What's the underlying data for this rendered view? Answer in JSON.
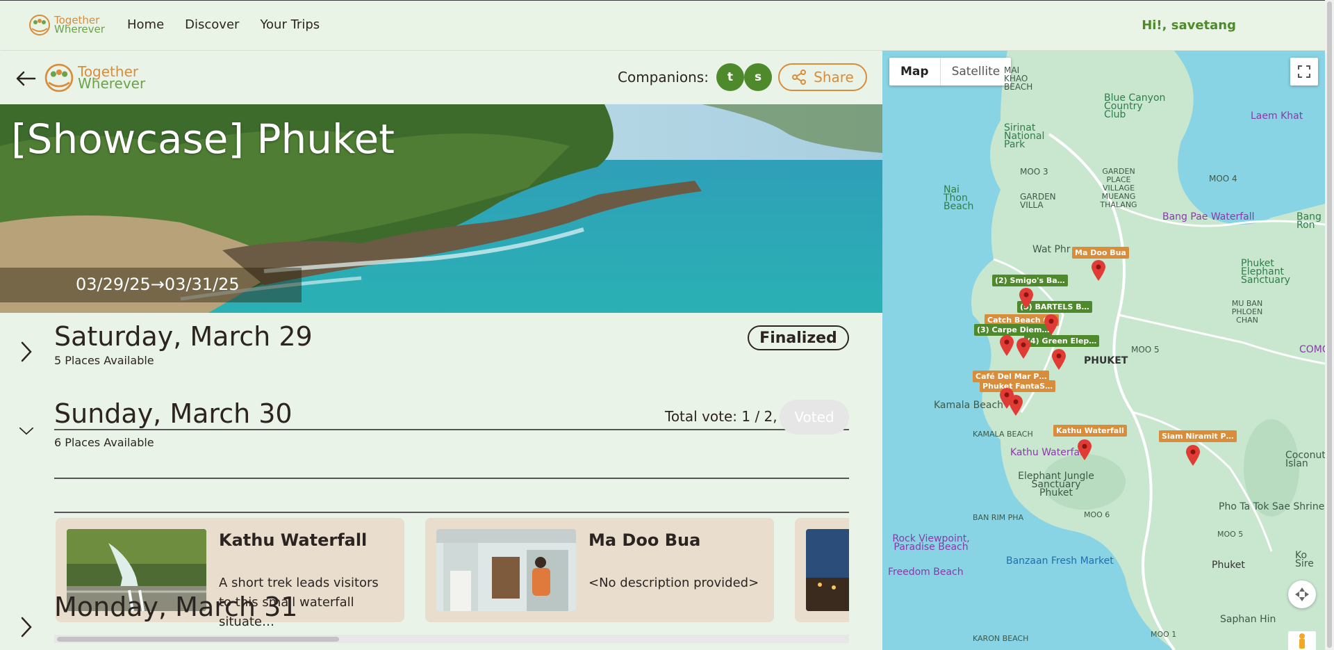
{
  "nav": {
    "brand_line1": "Together",
    "brand_line2": "Wherever",
    "links": [
      "Home",
      "Discover",
      "Your Trips"
    ],
    "greeting": "Hi!, savetang"
  },
  "trip": {
    "brand_line1": "Together",
    "brand_line2": "Wherever",
    "companions_label": "Companions:",
    "companions": [
      "t",
      "s"
    ],
    "share_label": "Share",
    "title": "[Showcase] Phuket",
    "dates": "03/29/25→03/31/25"
  },
  "days": [
    {
      "title": "Saturday, March 29",
      "sub": "5 Places Available",
      "status": "Finalized"
    },
    {
      "title": "Sunday, March 30",
      "sub": "6 Places Available",
      "votes": "Total vote: 1 / 2,",
      "vote_button": "Voted"
    },
    {
      "title": "Monday, March 31"
    }
  ],
  "cards": [
    {
      "title": "Kathu Waterfall",
      "desc": "A short trek leads visitors to this small waterfall situate…"
    },
    {
      "title": "Ma Doo Bua",
      "desc": "<No description provided>"
    }
  ],
  "map": {
    "toggle_map": "Map",
    "toggle_satellite": "Satellite",
    "pins": [
      {
        "label": "Ma Doo Bua",
        "color": "orange"
      },
      {
        "label": "(2) Smigo's Ba…",
        "color": "green"
      },
      {
        "label": "(5) BARTELS B…",
        "color": "green"
      },
      {
        "label": "Catch Beach C…",
        "color": "orange"
      },
      {
        "label": "(3) Carpe Diem…",
        "color": "green"
      },
      {
        "label": "(4) Green Elep…",
        "color": "green"
      },
      {
        "label": "Café Del Mar P…",
        "color": "orange"
      },
      {
        "label": "Phuket FantaS…",
        "color": "orange"
      },
      {
        "label": "Kathu Waterfall",
        "color": "orange"
      },
      {
        "label": "Siam Niramit P…",
        "color": "orange"
      }
    ],
    "places": {
      "mai_khao": "MAI KHAO BEACH",
      "blue_canyon": "Blue Canyon Country Club",
      "sirinat": "Sirinat National Park",
      "moo3": "MOO 3",
      "garden_villa": "GARDEN VILLA",
      "garden_place": "GARDEN PLACE VILLAGE MUEANG THALANG",
      "moo4": "MOO 4",
      "nai_thon": "Nai Thon Beach",
      "laem_khat": "Laem Khat",
      "bang_pae": "Bang Pae Waterfall",
      "bang_ron": "Bang Ron",
      "wat_phra": "Wat Phr",
      "phuket_elephant": "Phuket Elephant Sanctuary",
      "mu_ban": "MU BAN PHLOEN CHAN",
      "phuket_mid": "PHUKET",
      "moo5": "MOO 5",
      "comc": "COMC",
      "kamala_beach": "Kamala Beach",
      "kamala": "KAMALA BEACH",
      "kathu_wf": "Kathu Waterfall",
      "elephant_jungle": "Elephant Jungle Sanctuary Phuket",
      "coconut": "Coconut Islan",
      "ban_rim_pha": "BAN RIM PHA",
      "moo6": "MOO 6",
      "pho_ta_tok": "Pho Ta Tok Sae Shrine",
      "rock_viewpoint": "Rock Viewpoint, Paradise Beach",
      "banzaan": "Banzaan Fresh Market",
      "moo5b": "MOO 5",
      "ko_sire": "Ko Sire",
      "freedom": "Freedom Beach",
      "phuket_town": "Phuket",
      "saphan_hin": "Saphan Hin",
      "karon": "KARON BEACH",
      "moo1": "MOO 1"
    }
  },
  "colors": {
    "brand_orange": "#d98c3a",
    "brand_green": "#4e8a2c",
    "background": "#eaf3e8",
    "card": "#e9ddcd"
  }
}
